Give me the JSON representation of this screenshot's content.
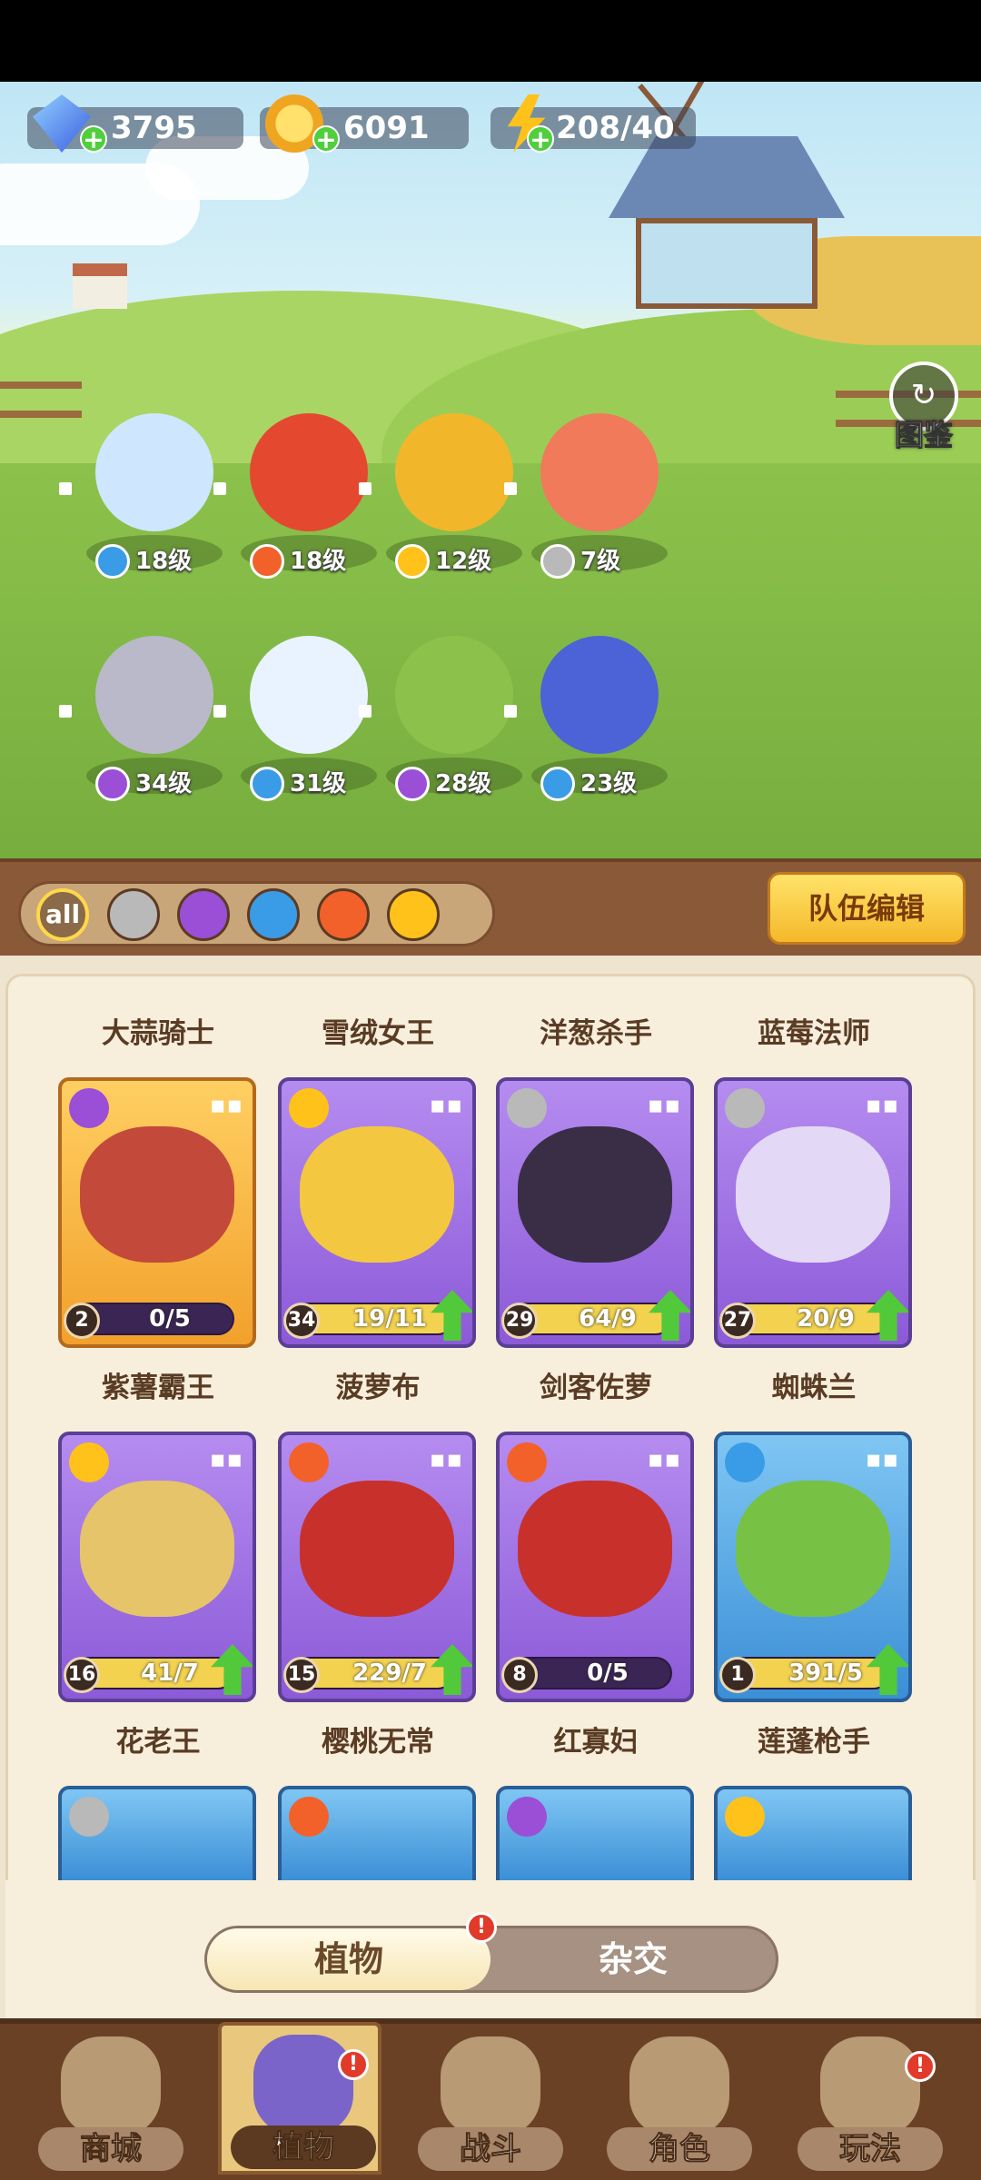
{
  "resources": {
    "gems": "3795",
    "coins": "6091",
    "energy": "208/40"
  },
  "atlas_label": "图鉴",
  "team_slots": [
    {
      "level": "18级",
      "element": "water"
    },
    {
      "level": "18级",
      "element": "fire"
    },
    {
      "level": "12级",
      "element": "lightning"
    },
    {
      "level": "7级",
      "element": "sword"
    },
    {
      "level": "34级",
      "element": "poison"
    },
    {
      "level": "31级",
      "element": "water"
    },
    {
      "level": "28级",
      "element": "poison"
    },
    {
      "level": "23级",
      "element": "water"
    }
  ],
  "filters": {
    "all_label": "all",
    "items": [
      "sword",
      "poison",
      "water",
      "fire",
      "lightning"
    ]
  },
  "team_edit_label": "队伍编辑",
  "top_row_names": [
    "大蒜骑士",
    "雪绒女王",
    "洋葱杀手",
    "蓝莓法师"
  ],
  "cards": [
    {
      "name": "紫薯霸王",
      "level": "2",
      "progress": "0/5",
      "fill": 0.0,
      "upgrade": false,
      "color": "gold",
      "element": "poison"
    },
    {
      "name": "菠萝布",
      "level": "34",
      "progress": "19/11",
      "fill": 1.0,
      "upgrade": true,
      "color": "purple",
      "element": "lightning"
    },
    {
      "name": "剑客佐萝",
      "level": "29",
      "progress": "64/9",
      "fill": 1.0,
      "upgrade": true,
      "color": "purple",
      "element": "sword"
    },
    {
      "name": "蜘蛛兰",
      "level": "27",
      "progress": "20/9",
      "fill": 1.0,
      "upgrade": true,
      "color": "purple",
      "element": "sword"
    },
    {
      "name": "花老王",
      "level": "16",
      "progress": "41/7",
      "fill": 1.0,
      "upgrade": true,
      "color": "purple",
      "element": "lightning"
    },
    {
      "name": "樱桃无常",
      "level": "15",
      "progress": "229/7",
      "fill": 1.0,
      "upgrade": true,
      "color": "purple",
      "element": "fire"
    },
    {
      "name": "红寡妇",
      "level": "8",
      "progress": "0/5",
      "fill": 0.0,
      "upgrade": false,
      "color": "purple",
      "element": "fire"
    },
    {
      "name": "莲蓬枪手",
      "level": "1",
      "progress": "391/5",
      "fill": 1.0,
      "upgrade": true,
      "color": "blue",
      "element": "water"
    }
  ],
  "partial_cards": [
    {
      "color": "blue",
      "element": "sword"
    },
    {
      "color": "blue",
      "element": "fire"
    },
    {
      "color": "blue",
      "element": "poison"
    },
    {
      "color": "blue",
      "element": "lightning"
    }
  ],
  "toggle": {
    "plants_label": "植物",
    "hybrid_label": "杂交",
    "alert": "!"
  },
  "nav": [
    {
      "label": "商城",
      "alert": false
    },
    {
      "label": "植物",
      "alert": true
    },
    {
      "label": "战斗",
      "alert": false
    },
    {
      "label": "角色",
      "alert": false
    },
    {
      "label": "玩法",
      "alert": true
    }
  ],
  "colors": {
    "water": "#3a9be6",
    "fire": "#f2612a",
    "lightning": "#ffc21b",
    "sword": "#b9b9b9",
    "poison": "#9a4fd6"
  }
}
